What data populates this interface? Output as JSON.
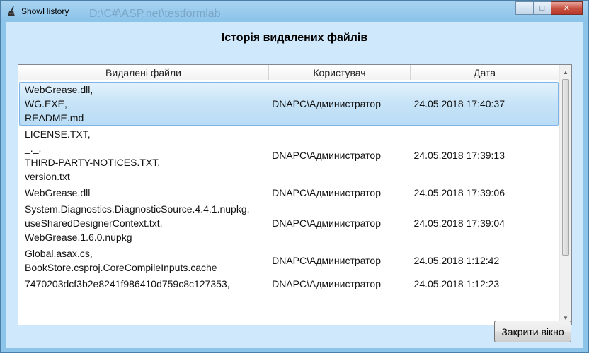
{
  "background_window": {
    "title": "D:\\C#\\ASP.net\\testformlab"
  },
  "window": {
    "title": "ShowHistory",
    "icon": "broom-icon",
    "buttons": {
      "minimize": "minimize-icon",
      "maximize": "maximize-icon",
      "close": "close-icon"
    }
  },
  "heading": "Історія видалених файлів",
  "grid": {
    "columns": [
      "Видалені файли",
      "Користувач",
      "Дата"
    ],
    "rows": [
      {
        "files": [
          "WebGrease.dll,",
          "WG.EXE,",
          "README.md"
        ],
        "user": "DNAPC\\Администратор",
        "date": "24.05.2018 17:40:37",
        "selected": true
      },
      {
        "files": [
          "LICENSE.TXT,",
          "_._,",
          "THIRD-PARTY-NOTICES.TXT,",
          "version.txt"
        ],
        "user": "DNAPC\\Администратор",
        "date": "24.05.2018 17:39:13",
        "selected": false
      },
      {
        "files": [
          "WebGrease.dll"
        ],
        "user": "DNAPC\\Администратор",
        "date": "24.05.2018 17:39:06",
        "selected": false
      },
      {
        "files": [
          "System.Diagnostics.DiagnosticSource.4.4.1.nupkg,",
          "useSharedDesignerContext.txt,",
          "WebGrease.1.6.0.nupkg"
        ],
        "user": "DNAPC\\Администратор",
        "date": "24.05.2018 17:39:04",
        "selected": false
      },
      {
        "files": [
          "Global.asax.cs,",
          "BookStore.csproj.CoreCompileInputs.cache"
        ],
        "user": "DNAPC\\Администратор",
        "date": "24.05.2018 1:12:42",
        "selected": false
      },
      {
        "files": [
          "7470203dcf3b2e8241f986410d759c8c127353,"
        ],
        "user": "DNAPC\\Администратор",
        "date": "24.05.2018 1:12:23",
        "selected": false
      }
    ]
  },
  "close_button_label": "Закрити вікно",
  "colors": {
    "accent": "#8cc4ea",
    "selection": "#c6e3f7",
    "client": "#cfe8fb"
  }
}
